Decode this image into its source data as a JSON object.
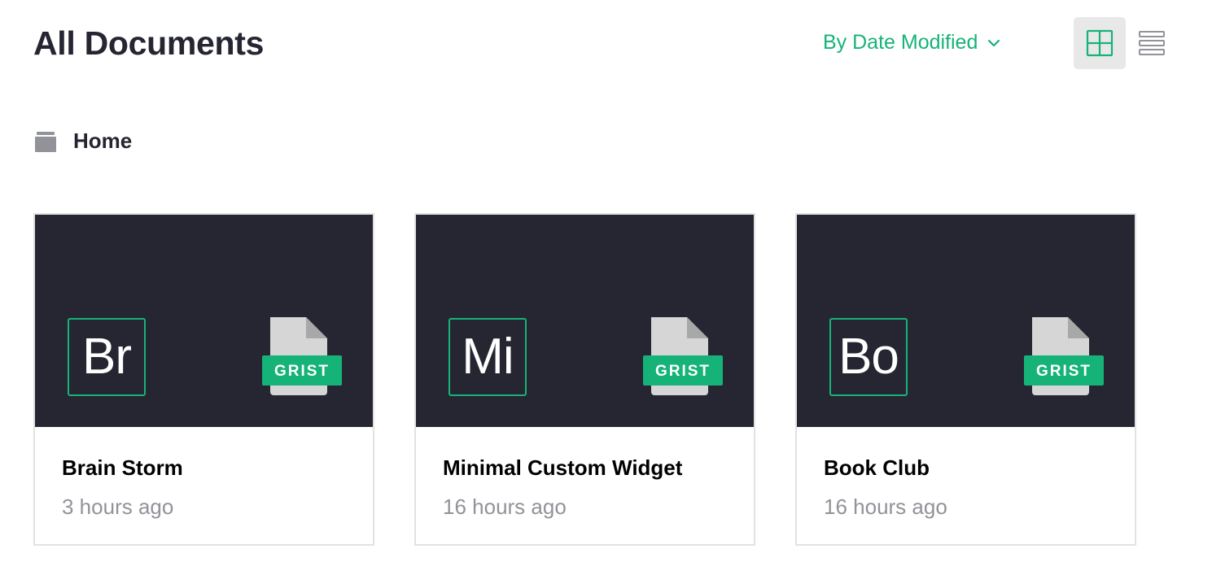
{
  "header": {
    "title": "All Documents",
    "sort_label": "By Date Modified",
    "sort_icon": "chevron-down-icon",
    "view_buttons": [
      {
        "name": "grid-view",
        "icon": "grid-icon",
        "active": true
      },
      {
        "name": "list-view",
        "icon": "list-icon",
        "active": false
      }
    ]
  },
  "folder": {
    "icon": "folder-icon",
    "label": "Home"
  },
  "documents": [
    {
      "initials": "Br",
      "name": "Brain Storm",
      "modified": "3 hours ago",
      "badge": "GRIST"
    },
    {
      "initials": "Mi",
      "name": "Minimal Custom Widget",
      "modified": "16 hours ago",
      "badge": "GRIST"
    },
    {
      "initials": "Bo",
      "name": "Book Club",
      "modified": "16 hours ago",
      "badge": "GRIST"
    }
  ],
  "colors": {
    "accent": "#16b378",
    "thumbnail_bg": "#262633",
    "muted_text": "#929299",
    "card_border": "#e2e2e2"
  }
}
